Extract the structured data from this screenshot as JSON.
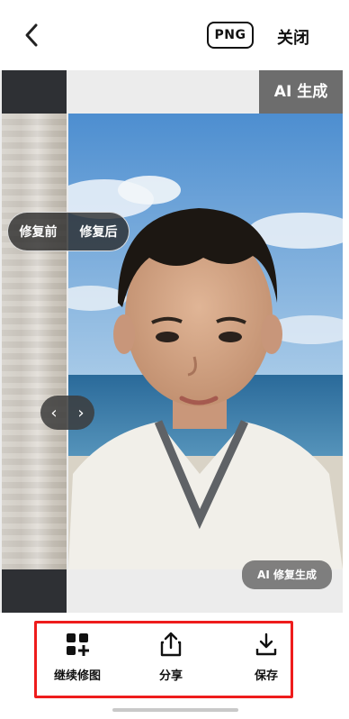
{
  "topbar": {
    "format_label": "PNG",
    "close_label": "关闭"
  },
  "image": {
    "ai_top_badge": "AI 生成",
    "compare": {
      "before_label": "修复前",
      "after_label": "修复后"
    },
    "slider": {
      "left_arrow": "‹",
      "right_arrow": "›"
    },
    "ai_bottom_badge": "AI 修复生成"
  },
  "actions": [
    {
      "label": "继续修图",
      "icon": "grid-plus-icon"
    },
    {
      "label": "分享",
      "icon": "share-icon"
    },
    {
      "label": "保存",
      "icon": "download-icon"
    }
  ],
  "colors": {
    "highlight_border": "#ee1c1c",
    "badge_gray": "#6d6d6d"
  }
}
